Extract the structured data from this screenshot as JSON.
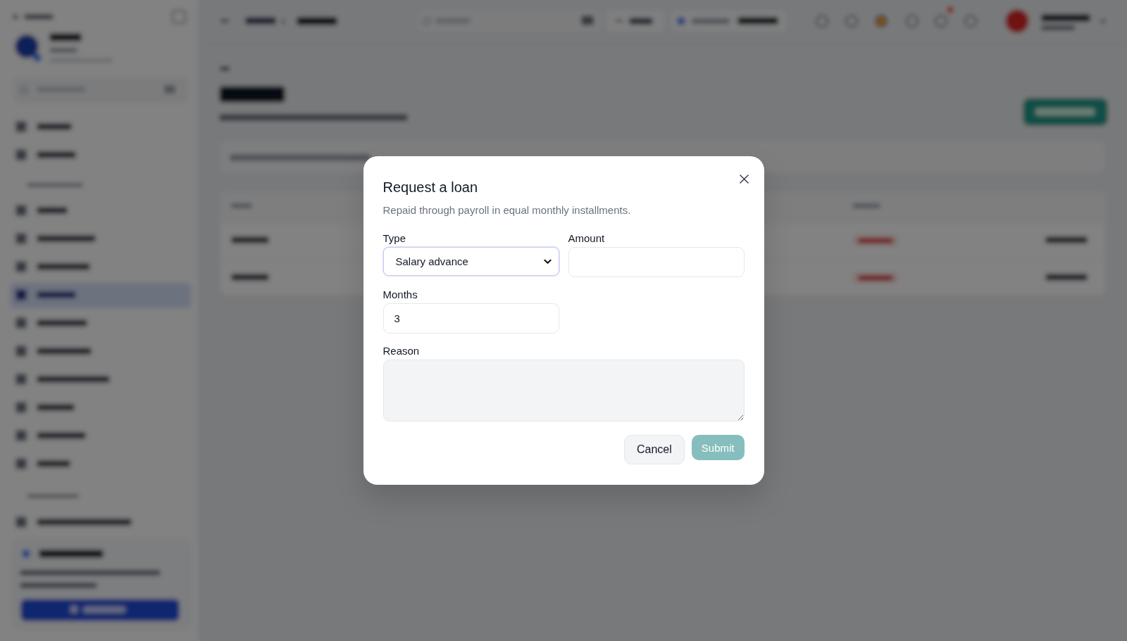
{
  "dialog": {
    "title": "Request a loan",
    "subtitle": "Repaid through payroll in equal monthly installments.",
    "fields": [
      {
        "kind": "select",
        "label": "Type",
        "value": "Salary advance",
        "focused": true
      },
      {
        "kind": "input",
        "label": "Amount",
        "focused": false
      },
      {
        "kind": "input",
        "label": "Months",
        "value": "3",
        "focused": false
      },
      {
        "kind": "textarea",
        "label": "Reason",
        "focused": false
      }
    ],
    "buttons": [
      {
        "kind": "secondary",
        "label": "Cancel",
        "disabled": false
      },
      {
        "kind": "primary",
        "label": "Submit",
        "disabled": true
      }
    ]
  }
}
